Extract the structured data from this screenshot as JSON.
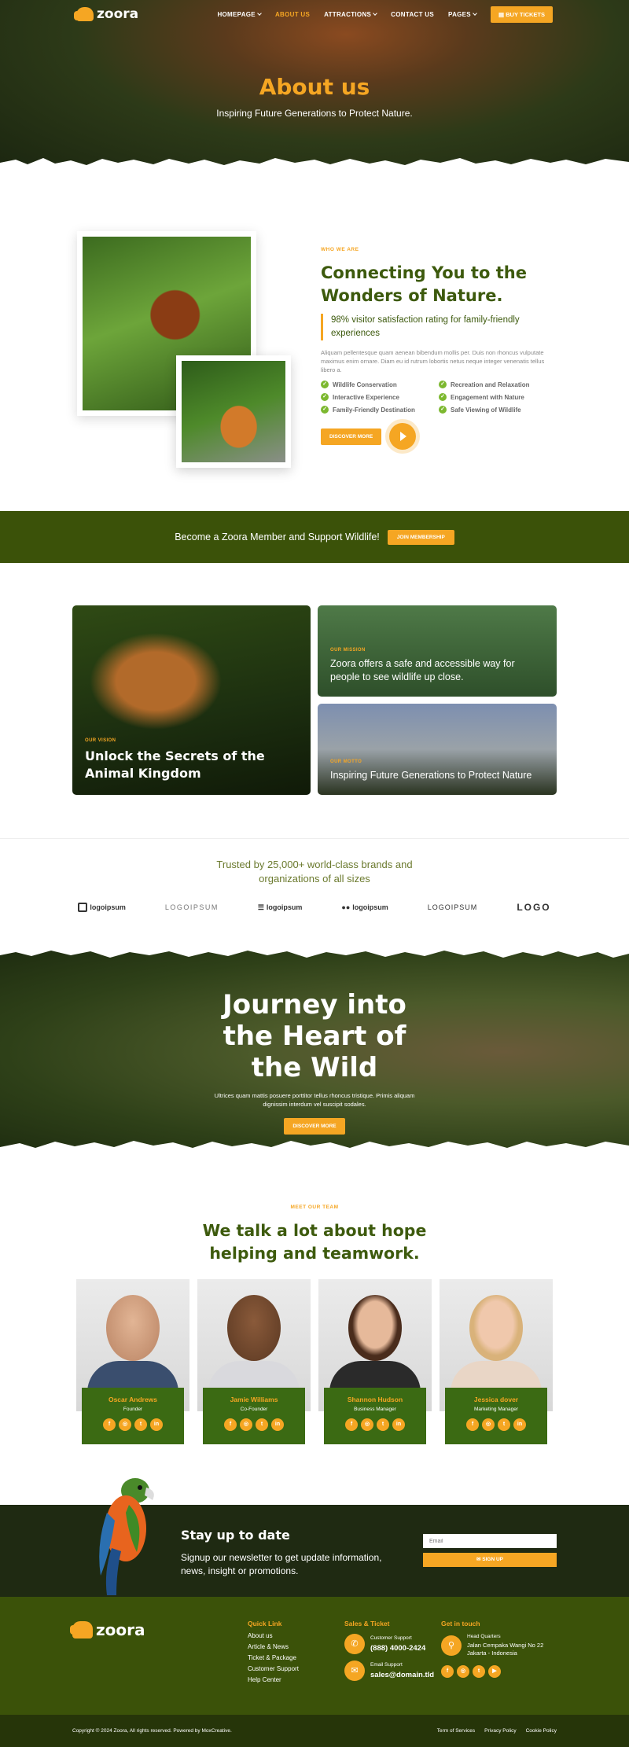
{
  "nav": {
    "logo": "zoora",
    "items": [
      {
        "label": "HOMEPAGE",
        "dropdown": true
      },
      {
        "label": "ABOUT US",
        "dropdown": false,
        "active": true
      },
      {
        "label": "ATTRACTIONS",
        "dropdown": true
      },
      {
        "label": "CONTACT US",
        "dropdown": false
      },
      {
        "label": "PAGES",
        "dropdown": true
      }
    ],
    "ticket_label": "BUY TICKETS"
  },
  "hero": {
    "title": "About us",
    "subtitle": "Inspiring Future Generations to Protect Nature."
  },
  "about": {
    "eyebrow": "WHO WE ARE",
    "title": "Connecting You to the Wonders of Nature.",
    "quote": "98% visitor satisfaction rating for family-friendly experiences",
    "paragraph": "Aliquam pellentesque quam aenean bibendum mollis per. Duis non rhoncus vulputate maximus enim ornare. Diam eu id rutrum lobortis netus neque integer venenatis tellus libero a.",
    "features": [
      "Wildlife Conservation",
      "Recreation and Relaxation",
      "Interactive Experience",
      "Engagement with Nature",
      "Family-Friendly Destination",
      "Safe Viewing of Wildlife"
    ],
    "button": "DISCOVER MORE"
  },
  "member": {
    "text": "Become a Zoora Member and Support Wildlife!",
    "button": "JOIN MEMBERSHIP"
  },
  "cards": {
    "vision": {
      "eyebrow": "OUR VISION",
      "title": "Unlock the Secrets of the Animal Kingdom"
    },
    "mission": {
      "eyebrow": "OUR MISSION",
      "title": "Zoora offers a safe and accessible way for people to see wildlife up close."
    },
    "motto": {
      "eyebrow": "OUR MOTTO",
      "title": "Inspiring Future Generations to Protect Nature"
    }
  },
  "trusted": {
    "title": "Trusted by 25,000+ world-class brands and organizations of all sizes",
    "logos": [
      "logoipsum",
      "LOGOIPSUM",
      "logoipsum",
      "logoipsum",
      "LOGOIPSUM",
      "LOGO"
    ]
  },
  "journey": {
    "title": "Journey into the Heart of the Wild",
    "text": "Ultrices quam mattis posuere porttitor tellus rhoncus tristique. Primis aliquam dignissim interdum vel suscipit sodales.",
    "button": "DISCOVER MORE"
  },
  "team": {
    "eyebrow": "MEET OUR TEAM",
    "title": "We talk a lot about hope helping and teamwork.",
    "members": [
      {
        "name": "Oscar Andrews",
        "role": "Founder"
      },
      {
        "name": "Jamie Williams",
        "role": "Co-Founder"
      },
      {
        "name": "Shannon Hudson",
        "role": "Business Manager"
      },
      {
        "name": "Jessica dover",
        "role": "Marketing Manager"
      }
    ]
  },
  "newsletter": {
    "title": "Stay up to date",
    "text": "Signup our newsletter to get update information, news, insight or promotions.",
    "email_placeholder": "Email",
    "button": "SIGN UP"
  },
  "footer": {
    "logo": "zoora",
    "quick_link_title": "Quick Link",
    "links": [
      "About us",
      "Article & News",
      "Ticket & Package",
      "Customer Support",
      "Help Center"
    ],
    "sales_title": "Sales & Ticket",
    "support_label": "Customer Support",
    "phone": "(888) 4000-2424",
    "email_label": "Email Support",
    "email": "sales@domain.tld",
    "contact_title": "Get in touch",
    "hq_label": "Head Quarters",
    "address": "Jalan Cempaka Wangi No 22 Jakarta - Indonesia",
    "copyright": "Copyright © 2024 Zoora, All rights reserved. Powered by MoxCreative.",
    "legal": [
      "Term of Services",
      "Privacy Policy",
      "Cookie Policy"
    ]
  },
  "colors": {
    "accent": "#f5a623",
    "primary_green": "#3b5209",
    "text_green": "#3d5a0d"
  }
}
